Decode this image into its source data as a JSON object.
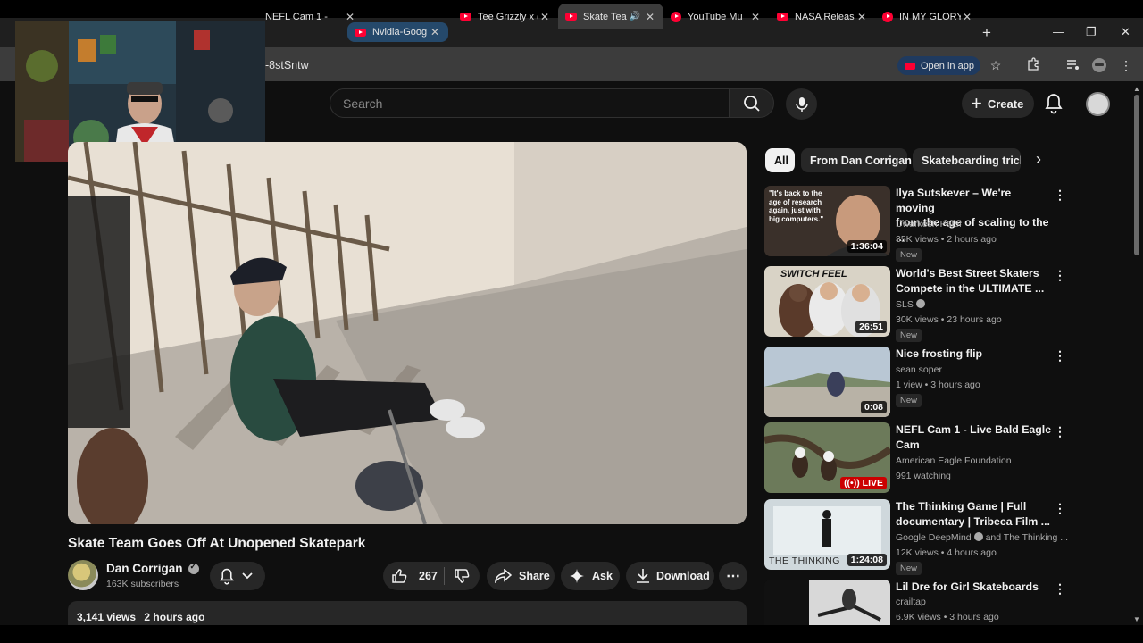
{
  "browser": {
    "tabs": [
      {
        "label": "NEFL Cam 1 -",
        "icon": "none",
        "state": "normal"
      },
      {
        "label": "Nvidia-Goog",
        "icon": "youtube",
        "state": "hover"
      },
      {
        "label": "Tee Grizzly x (",
        "icon": "youtube",
        "state": "normal"
      },
      {
        "label": "Skate Tea",
        "icon": "youtube",
        "state": "active",
        "audio": true
      },
      {
        "label": "YouTube Mu",
        "icon": "youtube-music",
        "state": "normal"
      },
      {
        "label": "NASA Releas",
        "icon": "youtube",
        "state": "normal"
      },
      {
        "label": "IN MY GLORY",
        "icon": "youtube-music",
        "state": "normal"
      }
    ],
    "new_tab": "+",
    "window_controls": {
      "minimize": "—",
      "restore": "❐",
      "close": "✕"
    },
    "url_fragment": "-8stSntw",
    "open_in_app": "Open in app"
  },
  "header": {
    "search_placeholder": "Search",
    "create_label": "Create"
  },
  "video": {
    "title": "Skate Team Goes Off At Unopened Skatepark",
    "channel": "Dan Corrigan",
    "subscribers": "163K subscribers",
    "likes": "267",
    "share": "Share",
    "ask": "Ask",
    "download": "Download",
    "views": "3,141 views",
    "uploaded": "2 hours ago"
  },
  "chips": [
    "All",
    "From Dan Corrigan",
    "Skateboarding trick"
  ],
  "recommendations": [
    {
      "title_line1": "Ilya Sutskever – We're moving",
      "title_line2": "from the age of scaling to the ...",
      "channel": "Dwarkesh Patel",
      "stats": "35K views • 2 hours ago",
      "badge": "New",
      "duration": "1:36:04",
      "thumb_text": "\"It's back to the age of research again, just with big computers.\""
    },
    {
      "title_line1": "World's Best Street Skaters",
      "title_line2": "Compete in the ULTIMATE ...",
      "channel": "SLS",
      "stats": "30K views • 23 hours ago",
      "badge": "New",
      "duration": "26:51",
      "thumb_text": "SWITCH FEEL"
    },
    {
      "title_line1": "Nice frosting flip",
      "title_line2": "",
      "channel": "sean soper",
      "stats": "1 view • 3 hours ago",
      "badge": "New",
      "duration": "0:08"
    },
    {
      "title_line1": "NEFL Cam 1 - Live Bald Eagle",
      "title_line2": "Cam",
      "channel": "American Eagle Foundation",
      "stats": "991 watching",
      "badge": "",
      "duration": "LIVE"
    },
    {
      "title_line1": "The Thinking Game | Full",
      "title_line2": "documentary | Tribeca Film ...",
      "channel": "Google DeepMind",
      "channel_extra": "and The Thinking ...",
      "stats": "12K views • 4 hours ago",
      "badge": "New",
      "duration": "1:24:08",
      "thumb_text": "THE THINKING"
    },
    {
      "title_line1": "Lil Dre for Girl Skateboards",
      "title_line2": "",
      "channel": "crailtap",
      "stats": "6.9K views • 3 hours ago",
      "badge": "",
      "duration": ""
    }
  ],
  "colors": {
    "background": "#0f0f0f",
    "surface": "#272727",
    "youtube_red": "#ff0033",
    "live_red": "#cc0000"
  }
}
